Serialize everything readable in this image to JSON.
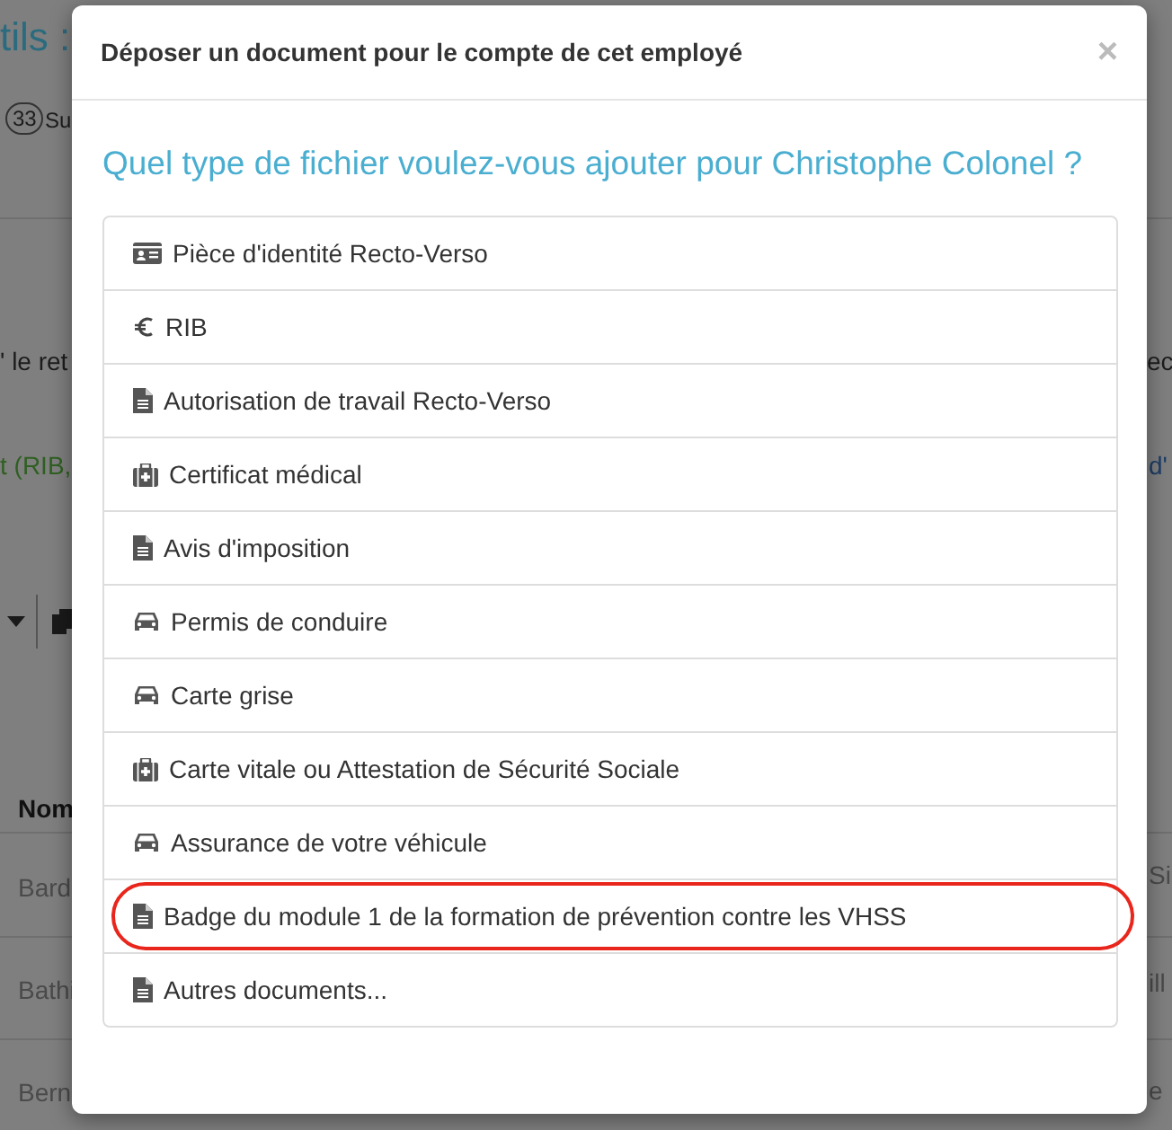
{
  "background": {
    "title_fragment": "tils :",
    "count_badge": "33",
    "count_label_fragment": "Su",
    "text_fragment_left": "' le ret",
    "text_fragment_right": "ec",
    "green_fragment": "t (RIB,",
    "link_fragment": "d'",
    "table_header_fragment": "Nom",
    "rows_left": [
      "Bard",
      "Bathi",
      "Bern"
    ],
    "rows_right": [
      "Si",
      "ill",
      "e"
    ]
  },
  "modal": {
    "title": "Déposer un document pour le compte de cet employé",
    "close": "×",
    "heading": "Quel type de fichier voulez-vous ajouter pour Christophe Colonel ?",
    "items": [
      {
        "label": "Pièce d'identité Recto-Verso",
        "kind": "identity",
        "highlighted": false
      },
      {
        "label": "RIB",
        "kind": "bank",
        "highlighted": false
      },
      {
        "label": "Autorisation de travail Recto-Verso",
        "kind": "document",
        "highlighted": false
      },
      {
        "label": "Certificat médical",
        "kind": "medical",
        "highlighted": false
      },
      {
        "label": "Avis d'imposition",
        "kind": "document",
        "highlighted": false
      },
      {
        "label": "Permis de conduire",
        "kind": "vehicle",
        "highlighted": false
      },
      {
        "label": "Carte grise",
        "kind": "vehicle",
        "highlighted": false
      },
      {
        "label": "Carte vitale ou Attestation de Sécurité Sociale",
        "kind": "medical",
        "highlighted": false
      },
      {
        "label": "Assurance de votre véhicule",
        "kind": "vehicle",
        "highlighted": false
      },
      {
        "label": "Badge du module 1 de la formation de prévention contre les VHSS",
        "kind": "document",
        "highlighted": true
      },
      {
        "label": "Autres documents...",
        "kind": "document",
        "highlighted": false
      }
    ]
  }
}
